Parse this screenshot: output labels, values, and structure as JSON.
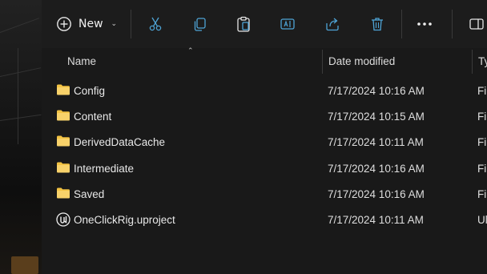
{
  "toolbar": {
    "new_label": "New",
    "buttons": [
      "cut-icon",
      "copy-icon",
      "paste-icon",
      "rename-icon",
      "share-icon",
      "delete-icon",
      "more-icon",
      "view-icon"
    ]
  },
  "columns": {
    "name": "Name",
    "date": "Date modified",
    "type": "Ty"
  },
  "files": [
    {
      "name": "Config",
      "date": "7/17/2024 10:16 AM",
      "type": "Fi",
      "icon": "folder-icon"
    },
    {
      "name": "Content",
      "date": "7/17/2024 10:15 AM",
      "type": "Fi",
      "icon": "folder-icon"
    },
    {
      "name": "DerivedDataCache",
      "date": "7/17/2024 10:11 AM",
      "type": "Fi",
      "icon": "folder-icon"
    },
    {
      "name": "Intermediate",
      "date": "7/17/2024 10:16 AM",
      "type": "Fi",
      "icon": "folder-icon"
    },
    {
      "name": "Saved",
      "date": "7/17/2024 10:16 AM",
      "type": "Fi",
      "icon": "folder-icon"
    },
    {
      "name": "OneClickRig.uproject",
      "date": "7/17/2024 10:11 AM",
      "type": "Ul",
      "icon": "unreal-project-icon"
    }
  ],
  "colors": {
    "folder": "#f3c343",
    "background": "#191919",
    "accent_icon": "#4ea4d6"
  }
}
